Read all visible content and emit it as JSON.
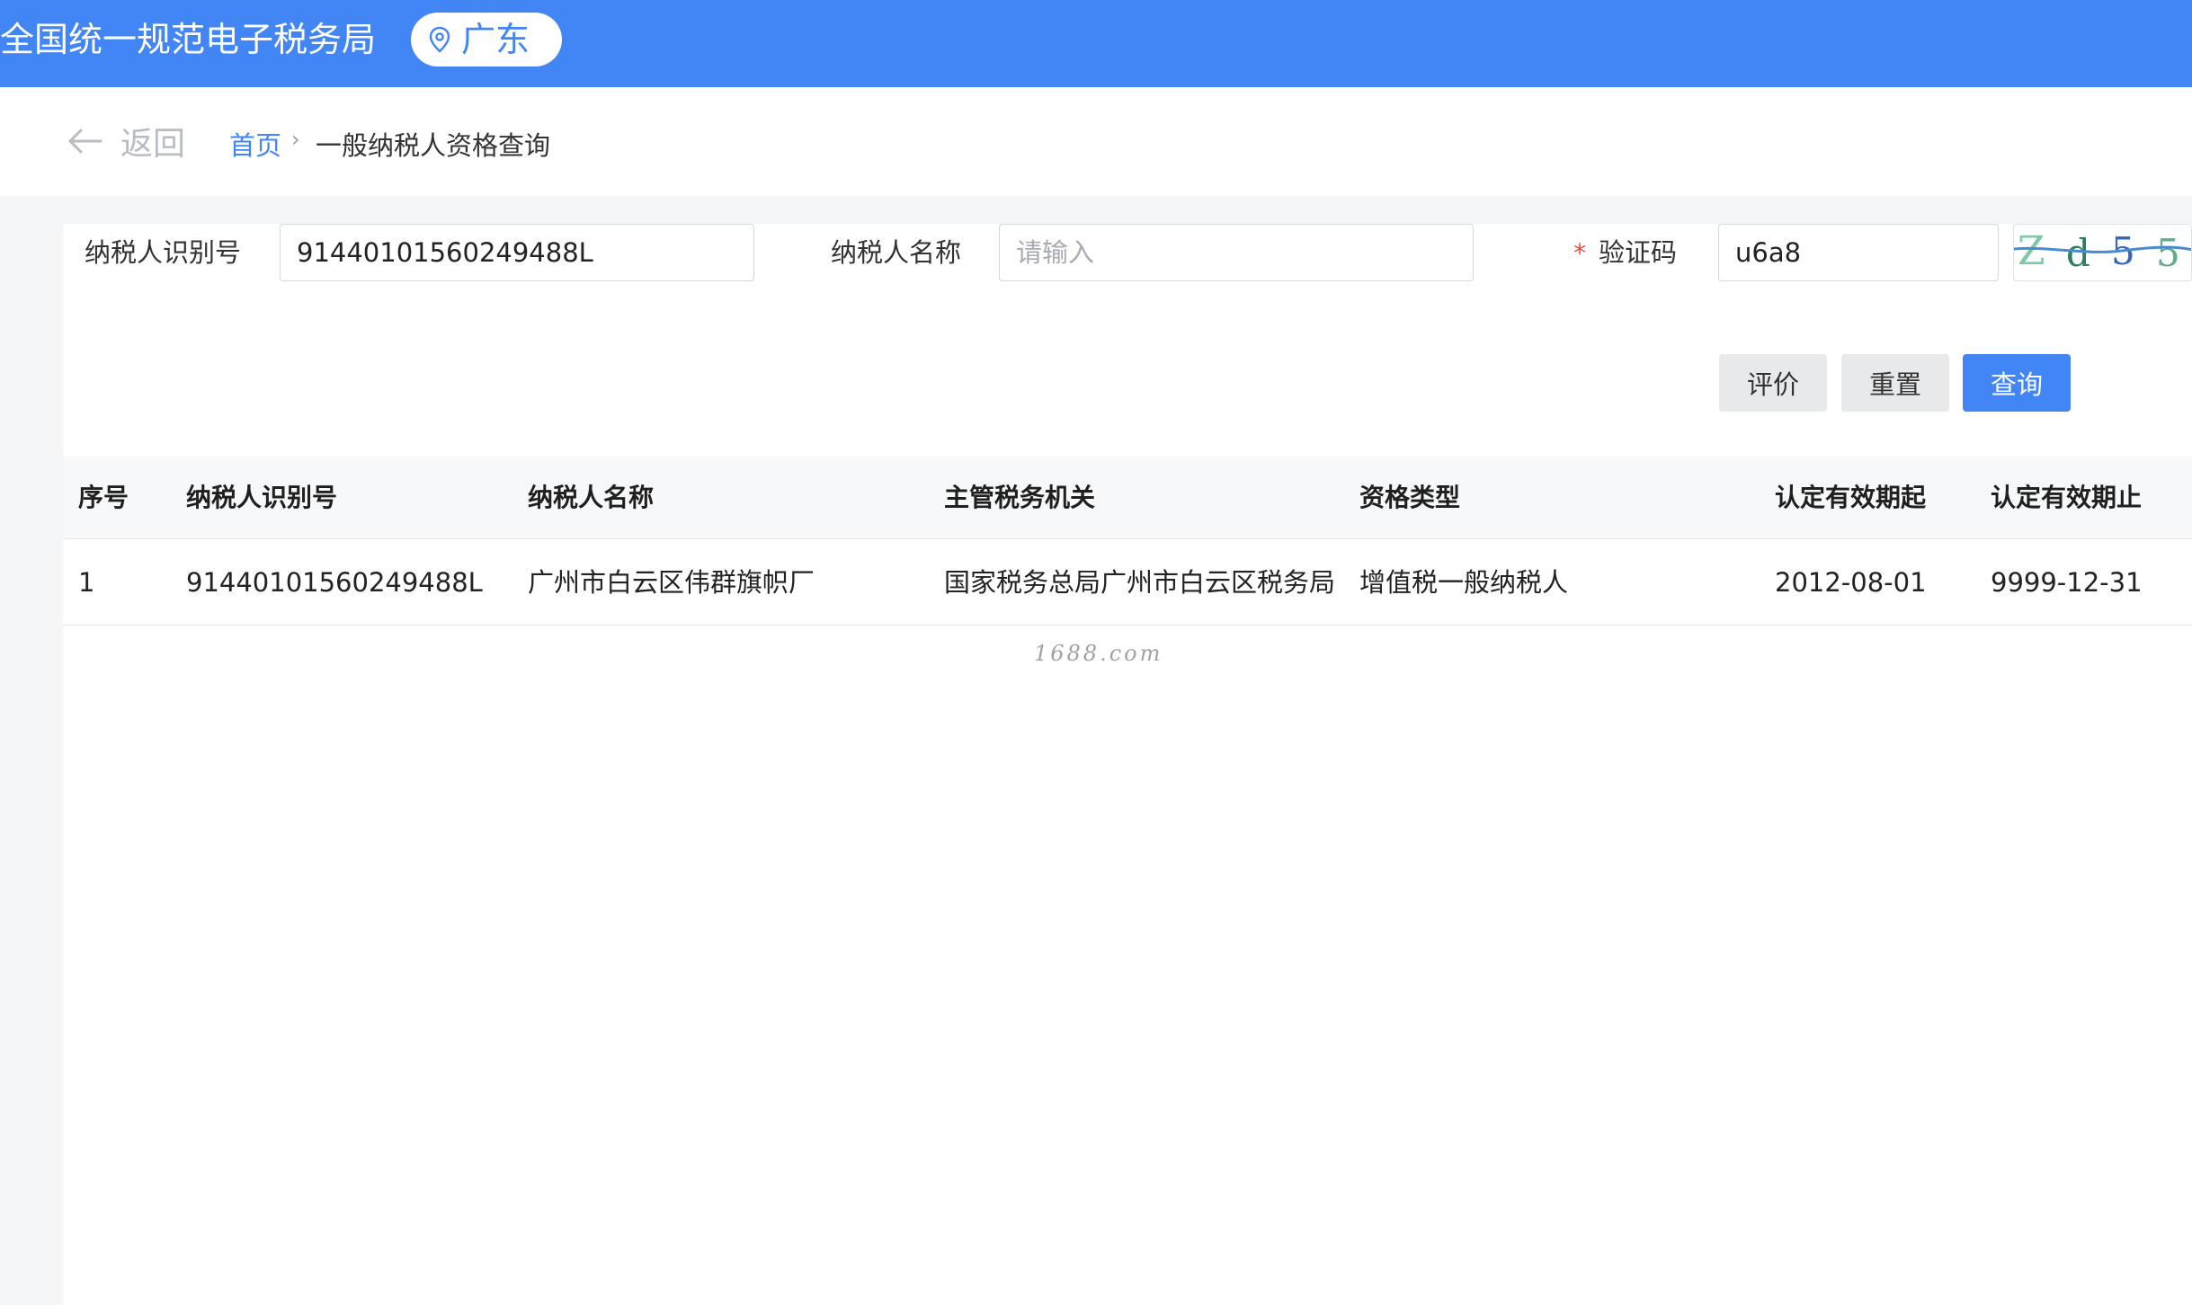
{
  "header": {
    "title": "全国统一规范电子税务局",
    "region": "广东",
    "background_color": "#4285f4"
  },
  "breadcrumb": {
    "back_label": "返回",
    "home_label": "首页",
    "separator": "›",
    "current_label": "一般纳税人资格查询"
  },
  "form": {
    "taxpayer_id_label": "纳税人识别号",
    "taxpayer_id_value": "91440101560249488L",
    "taxpayer_name_label": "纳税人名称",
    "taxpayer_name_placeholder": "请输入",
    "taxpayer_name_value": "",
    "captcha_required_mark": "*",
    "captcha_label": "验证码",
    "captcha_value": "u6a8",
    "captcha_image_text": "Zd55"
  },
  "buttons": {
    "evaluate_label": "评价",
    "reset_label": "重置",
    "query_label": "查询"
  },
  "table": {
    "columns": [
      "序号",
      "纳税人识别号",
      "纳税人名称",
      "主管税务机关",
      "资格类型",
      "认定有效期起",
      "认定有效期止"
    ],
    "rows": [
      [
        "1",
        "91440101560249488L",
        "广州市白云区伟群旗帜厂",
        "国家税务总局广州市白云区税务局",
        "增值税一般纳税人",
        "2012-08-01",
        "9999-12-31"
      ]
    ]
  },
  "watermark": "1688.com"
}
